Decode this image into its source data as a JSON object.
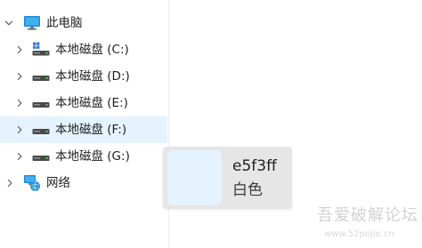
{
  "tree": {
    "items": [
      {
        "label": "此电脑",
        "icon": "computer-icon",
        "expanded": true
      },
      {
        "label": "本地磁盘 (C:)",
        "icon": "windows-drive-icon",
        "expanded": false
      },
      {
        "label": "本地磁盘 (D:)",
        "icon": "drive-icon",
        "expanded": false
      },
      {
        "label": "本地磁盘 (E:)",
        "icon": "drive-icon",
        "expanded": false
      },
      {
        "label": "本地磁盘 (F:)",
        "icon": "drive-icon",
        "expanded": false,
        "selected": true
      },
      {
        "label": "本地磁盘 (G:)",
        "icon": "drive-icon",
        "expanded": false
      },
      {
        "label": "网络",
        "icon": "network-icon",
        "expanded": false
      }
    ]
  },
  "tooltip": {
    "hex": "e5f3ff",
    "name": "白色",
    "swatch_color": "#e5f3ff"
  },
  "watermark": {
    "text": "吾爱破解论坛",
    "url": "www.52pojie.cn"
  },
  "colors": {
    "selected_row": "#e5f3ff",
    "divider": "#ededed",
    "tooltip_bg": "#e6e6e6"
  }
}
